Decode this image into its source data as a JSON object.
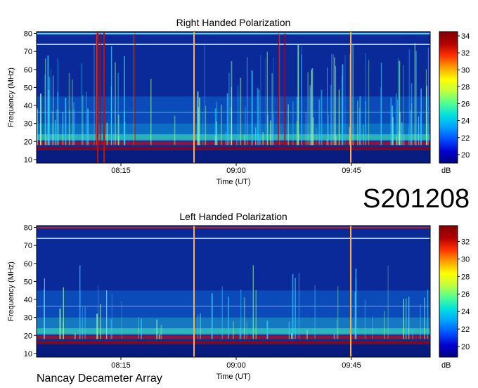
{
  "dataset_id": "S201208",
  "footer": "Nancay Decameter Array",
  "colors": {
    "background_blue": "#0a2a9a",
    "colormap": [
      "#000080",
      "#0000d0",
      "#0050ff",
      "#00a0ff",
      "#00e0e0",
      "#50ff90",
      "#c0ff40",
      "#ffff00",
      "#ffa000",
      "#ff3000",
      "#b00000",
      "#800000"
    ]
  },
  "chart_data": [
    {
      "type": "heatmap",
      "title": "Right Handed Polarization",
      "xlabel": "Time (UT)",
      "ylabel": "Frequency (MHz)",
      "x_ticks": [
        "08:15",
        "09:00",
        "09:45"
      ],
      "y_ticks": [
        10,
        20,
        30,
        40,
        50,
        60,
        70,
        80
      ],
      "ylim": [
        8,
        81
      ],
      "colorbar": {
        "label": "dB",
        "ticks": [
          20,
          22,
          24,
          26,
          28,
          30,
          32,
          34
        ],
        "range": [
          19,
          34.5
        ]
      }
    },
    {
      "type": "heatmap",
      "title": "Left Handed Polarization",
      "xlabel": "Time (UT)",
      "ylabel": "Frequency (MHz)",
      "x_ticks": [
        "08:15",
        "09:00",
        "09:45"
      ],
      "y_ticks": [
        10,
        20,
        30,
        40,
        50,
        60,
        70,
        80
      ],
      "ylim": [
        8,
        81
      ],
      "colorbar": {
        "label": "dB",
        "ticks": [
          20,
          22,
          24,
          26,
          28,
          30,
          32
        ],
        "range": [
          18.8,
          33.8
        ]
      }
    }
  ]
}
